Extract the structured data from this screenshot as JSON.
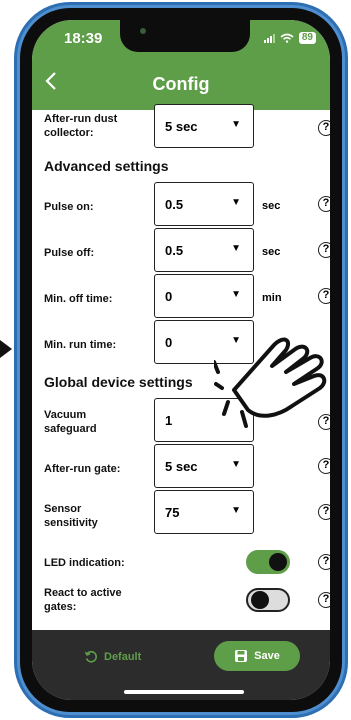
{
  "status": {
    "time": "18:39",
    "battery": "89"
  },
  "nav": {
    "title": "Config",
    "back_icon": "chevron-left-icon"
  },
  "rows": {
    "after_run_dust": {
      "label": "After-run dust collector:",
      "value": "5 sec"
    },
    "section_advanced": "Advanced settings",
    "pulse_on": {
      "label": "Pulse on:",
      "value": "0.5",
      "unit": "sec"
    },
    "pulse_off": {
      "label": "Pulse off:",
      "value": "0.5",
      "unit": "sec"
    },
    "min_off": {
      "label": "Min. off time:",
      "value": "0",
      "unit": "min"
    },
    "min_run": {
      "label": "Min. run time:",
      "value": "0"
    },
    "section_global": "Global device settings",
    "vacuum": {
      "label": "Vacuum safeguard",
      "value": "1"
    },
    "after_run_gate": {
      "label": "After-run gate:",
      "value": "5 sec"
    },
    "sensor": {
      "label": "Sensor sensitivity",
      "value": "75"
    },
    "led": {
      "label": "LED indication:",
      "enabled": true
    },
    "react": {
      "label": "React to active gates:",
      "enabled": false
    }
  },
  "help_symbol": "?",
  "caret_symbol": "▼",
  "footer": {
    "default_label": "Default",
    "save_label": "Save"
  },
  "colors": {
    "accent": "#5e9e48",
    "bottom_bar": "#2c2c2c"
  }
}
